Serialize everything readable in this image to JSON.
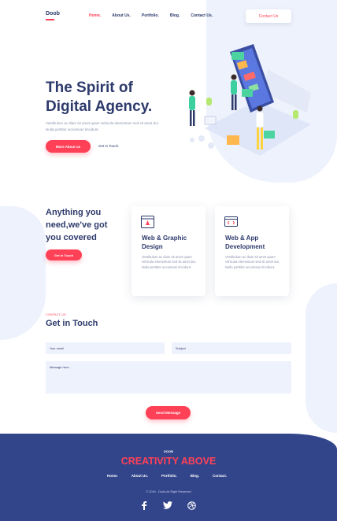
{
  "nav": {
    "logo": "Doob",
    "links": [
      {
        "label": "Home.",
        "active": true
      },
      {
        "label": "About Us.",
        "active": false
      },
      {
        "label": "Portfolio.",
        "active": false
      },
      {
        "label": "Blog.",
        "active": false
      },
      {
        "label": "Contact Us.",
        "active": false
      }
    ],
    "contact_button": "Contact Us"
  },
  "hero": {
    "title_line1": "The Spirit of",
    "title_line2": "Digital Agency.",
    "text": "Vestibulum ac diam sit amet quam vehicula elementum sed sit amet dui. Nulla porttitor accumsan tincidunt.",
    "primary_button": "More About us",
    "secondary_link": "Get in Touch."
  },
  "services": {
    "title": "Anything you need,we've got you covered",
    "button": "Get in Touch",
    "cards": [
      {
        "icon": "browser-design-icon",
        "title": "Web & Graphic Design",
        "text": "Vestibulum ac diam sit amet quam vehicula elementum sed sit amet dui. Nulla porttitor accumsan tincidunt."
      },
      {
        "icon": "code-window-icon",
        "title": "Web & App Development",
        "text": "Vestibulum ac diam sit amet quam vehicula elementum sed sit amet dui. Nulla porttitor accumsan tincidunt."
      }
    ]
  },
  "contact": {
    "label": "CONTACT US",
    "title": "Get in Touch",
    "email_placeholder": "Your email",
    "subject_placeholder": "Subject",
    "message_placeholder": "Message here...",
    "send_button": "Send Message"
  },
  "footer": {
    "brand": "DOOB",
    "slogan": "CREATIVITY ABOVE",
    "links": [
      "Home.",
      "About Us.",
      "Portfolio.",
      "Blog.",
      "Contact."
    ],
    "copyright": "© 2019 - Doob,All Right Reserved",
    "social": [
      "facebook-icon",
      "twitter-icon",
      "dribbble-icon"
    ]
  },
  "colors": {
    "accent": "#ff4158",
    "primary": "#2d3a6b",
    "footer_bg": "#32458a",
    "light_bg": "#eef2fc"
  }
}
